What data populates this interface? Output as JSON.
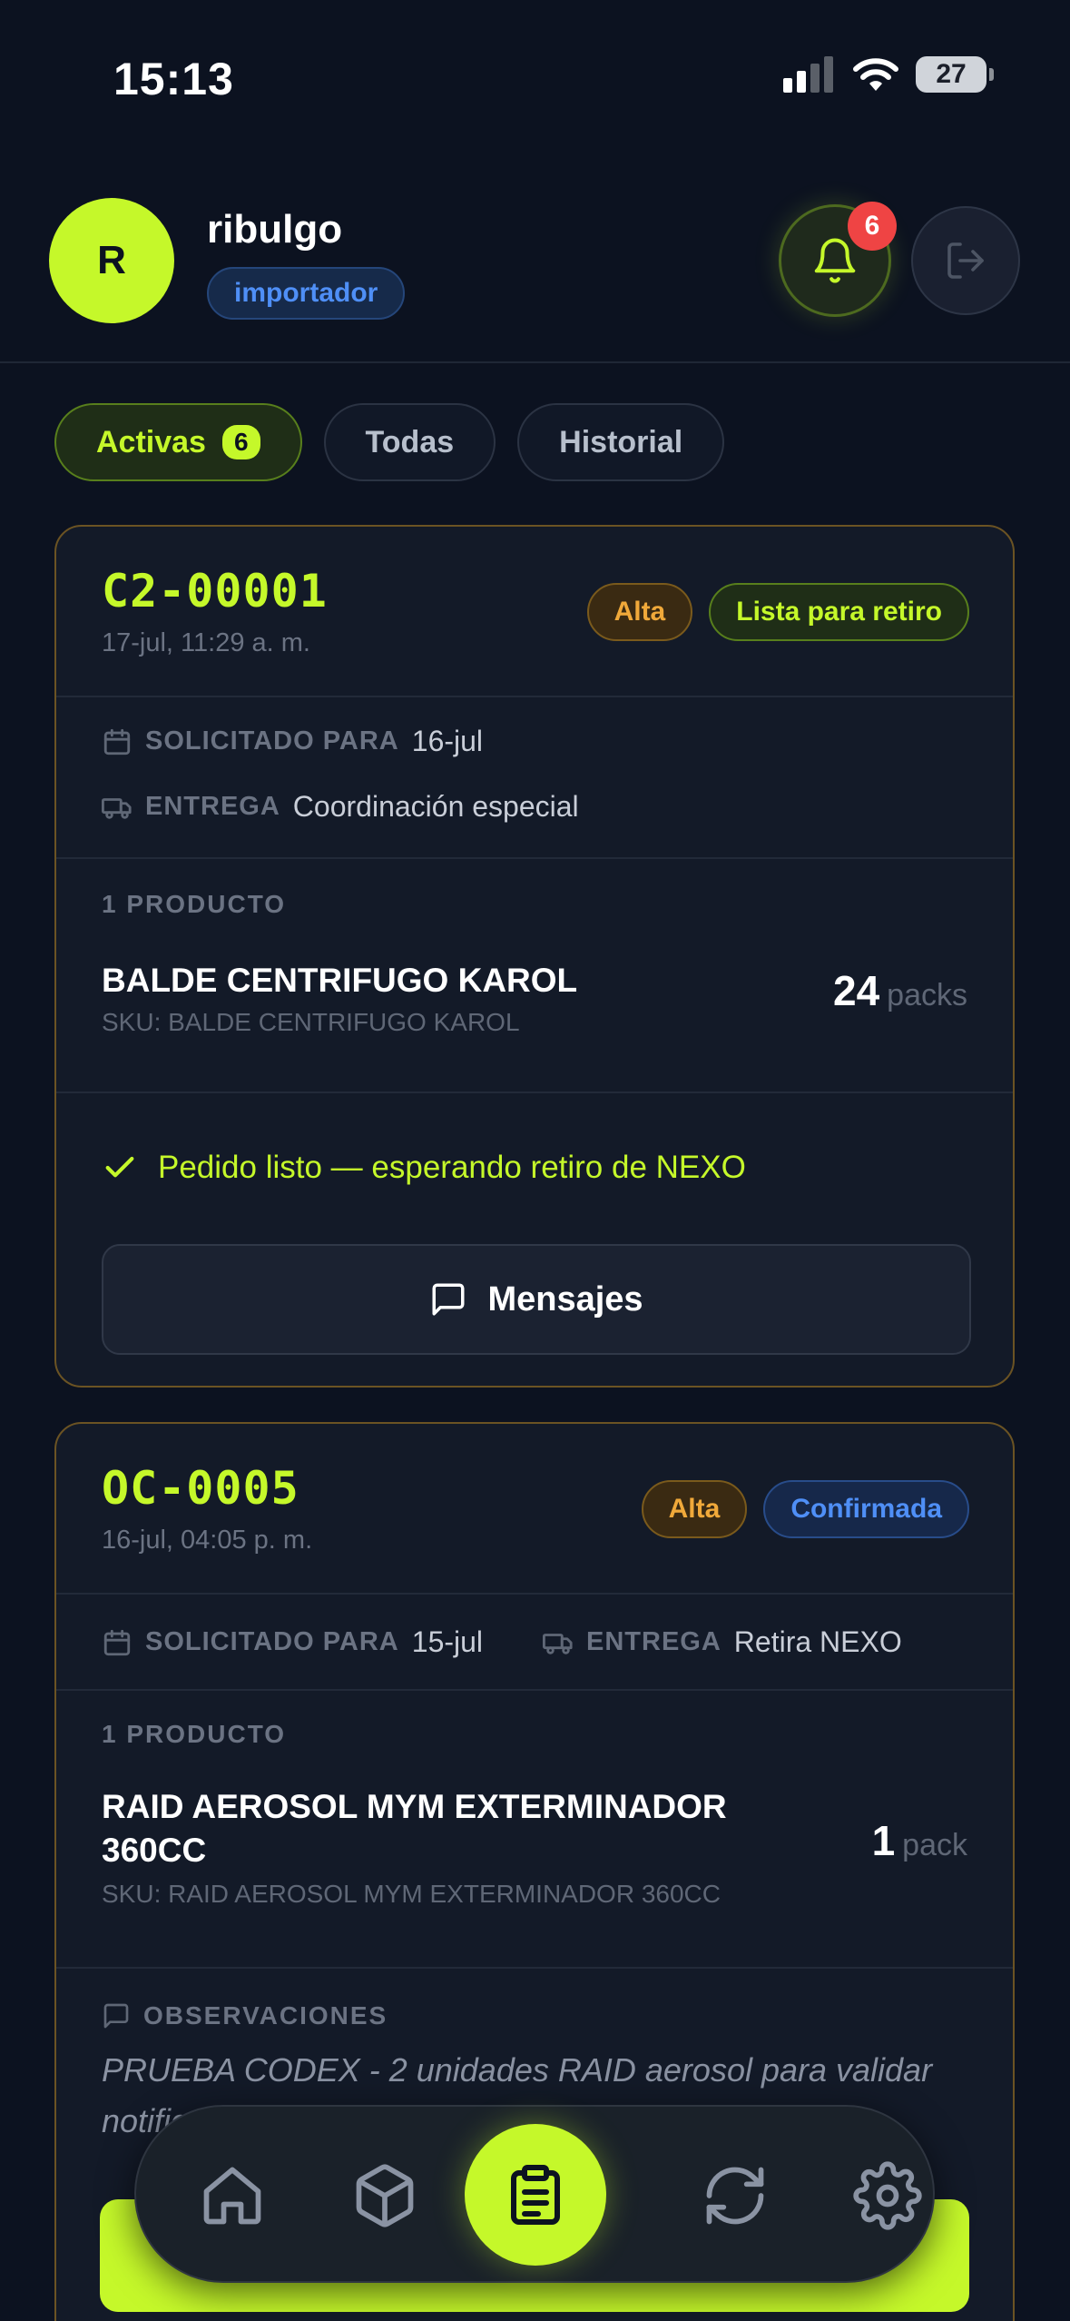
{
  "status_bar": {
    "time": "15:13",
    "battery": "27"
  },
  "header": {
    "avatar_initial": "R",
    "username": "ribulgo",
    "role": "importador",
    "notifications_count": "6"
  },
  "tabs": [
    {
      "label": "Activas",
      "count": "6",
      "active": true
    },
    {
      "label": "Todas",
      "active": false
    },
    {
      "label": "Historial",
      "active": false
    }
  ],
  "orders": [
    {
      "id": "C2-00001",
      "date": "17-jul, 11:29 a. m.",
      "priority": "Alta",
      "status": "Lista para retiro",
      "requested_key": "SOLICITADO PARA",
      "requested_value": "16-jul",
      "delivery_key": "ENTREGA",
      "delivery_value": "Coordinación especial",
      "products_title": "1 PRODUCTO",
      "product_name": "BALDE CENTRIFUGO KAROL",
      "product_sku": "SKU: BALDE CENTRIFUGO KAROL",
      "qty": "24",
      "qty_unit": "packs",
      "ready_text": "Pedido listo — esperando retiro de NEXO",
      "messages_label": "Mensajes"
    },
    {
      "id": "OC-0005",
      "date": "16-jul, 04:05 p. m.",
      "priority": "Alta",
      "status": "Confirmada",
      "requested_key": "SOLICITADO PARA",
      "requested_value": "15-jul",
      "delivery_key": "ENTREGA",
      "delivery_value": "Retira NEXO",
      "products_title": "1 PRODUCTO",
      "product_name_line1": "RAID AEROSOL MYM EXTERMINADOR",
      "product_name_line2": "360CC",
      "product_sku": "SKU: RAID AEROSOL MYM EXTERMINADOR 360CC",
      "qty": "1",
      "qty_unit": "pack",
      "observations_title": "OBSERVACIONES",
      "observations_text": "PRUEBA CODEX - 2 unidades RAID aerosol para validar notificación de pronto pedido"
    }
  ],
  "nav": [
    "home-icon",
    "box-icon",
    "clipboard-icon",
    "refresh-icon",
    "settings-icon"
  ],
  "colors": {
    "accent": "#c5f82a",
    "background": "#0c1220",
    "card": "#131a28",
    "priority": "#f0a93a",
    "info": "#4f8ff6"
  }
}
